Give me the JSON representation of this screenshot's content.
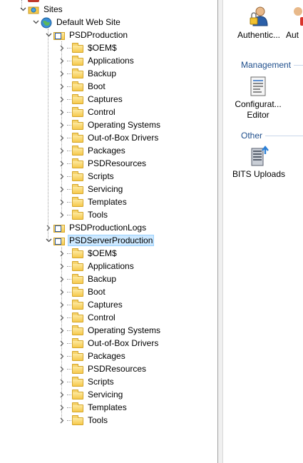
{
  "tree": {
    "partial_top_label": "",
    "sites_label": "Sites",
    "default_site_label": "Default Web Site",
    "apps": [
      {
        "label": "PSDProduction",
        "expanded": true,
        "selected": false,
        "folders": [
          "$OEM$",
          "Applications",
          "Backup",
          "Boot",
          "Captures",
          "Control",
          "Operating Systems",
          "Out-of-Box Drivers",
          "Packages",
          "PSDResources",
          "Scripts",
          "Servicing",
          "Templates",
          "Tools"
        ]
      },
      {
        "label": "PSDProductionLogs",
        "expanded": false,
        "selected": false,
        "folders": []
      },
      {
        "label": "PSDServerProduction",
        "expanded": true,
        "selected": true,
        "folders": [
          "$OEM$",
          "Applications",
          "Backup",
          "Boot",
          "Captures",
          "Control",
          "Operating Systems",
          "Out-of-Box Drivers",
          "Packages",
          "PSDResources",
          "Scripts",
          "Servicing",
          "Templates",
          "Tools"
        ]
      }
    ]
  },
  "features": {
    "top": [
      {
        "label": "Authentic...",
        "icon": "authentication-icon"
      },
      {
        "label": "Aut",
        "icon": "authorization-icon"
      }
    ],
    "management": {
      "header": "Management",
      "items": [
        {
          "label_line1": "Configurat...",
          "label_line2": "Editor",
          "icon": "configuration-editor-icon"
        }
      ]
    },
    "other": {
      "header": "Other",
      "items": [
        {
          "label": "BITS Uploads",
          "icon": "bits-uploads-icon"
        }
      ]
    }
  },
  "colors": {
    "selection_bg": "#cce8ff",
    "group_header": "#1e4e8c",
    "folder": "#f6c94c"
  }
}
